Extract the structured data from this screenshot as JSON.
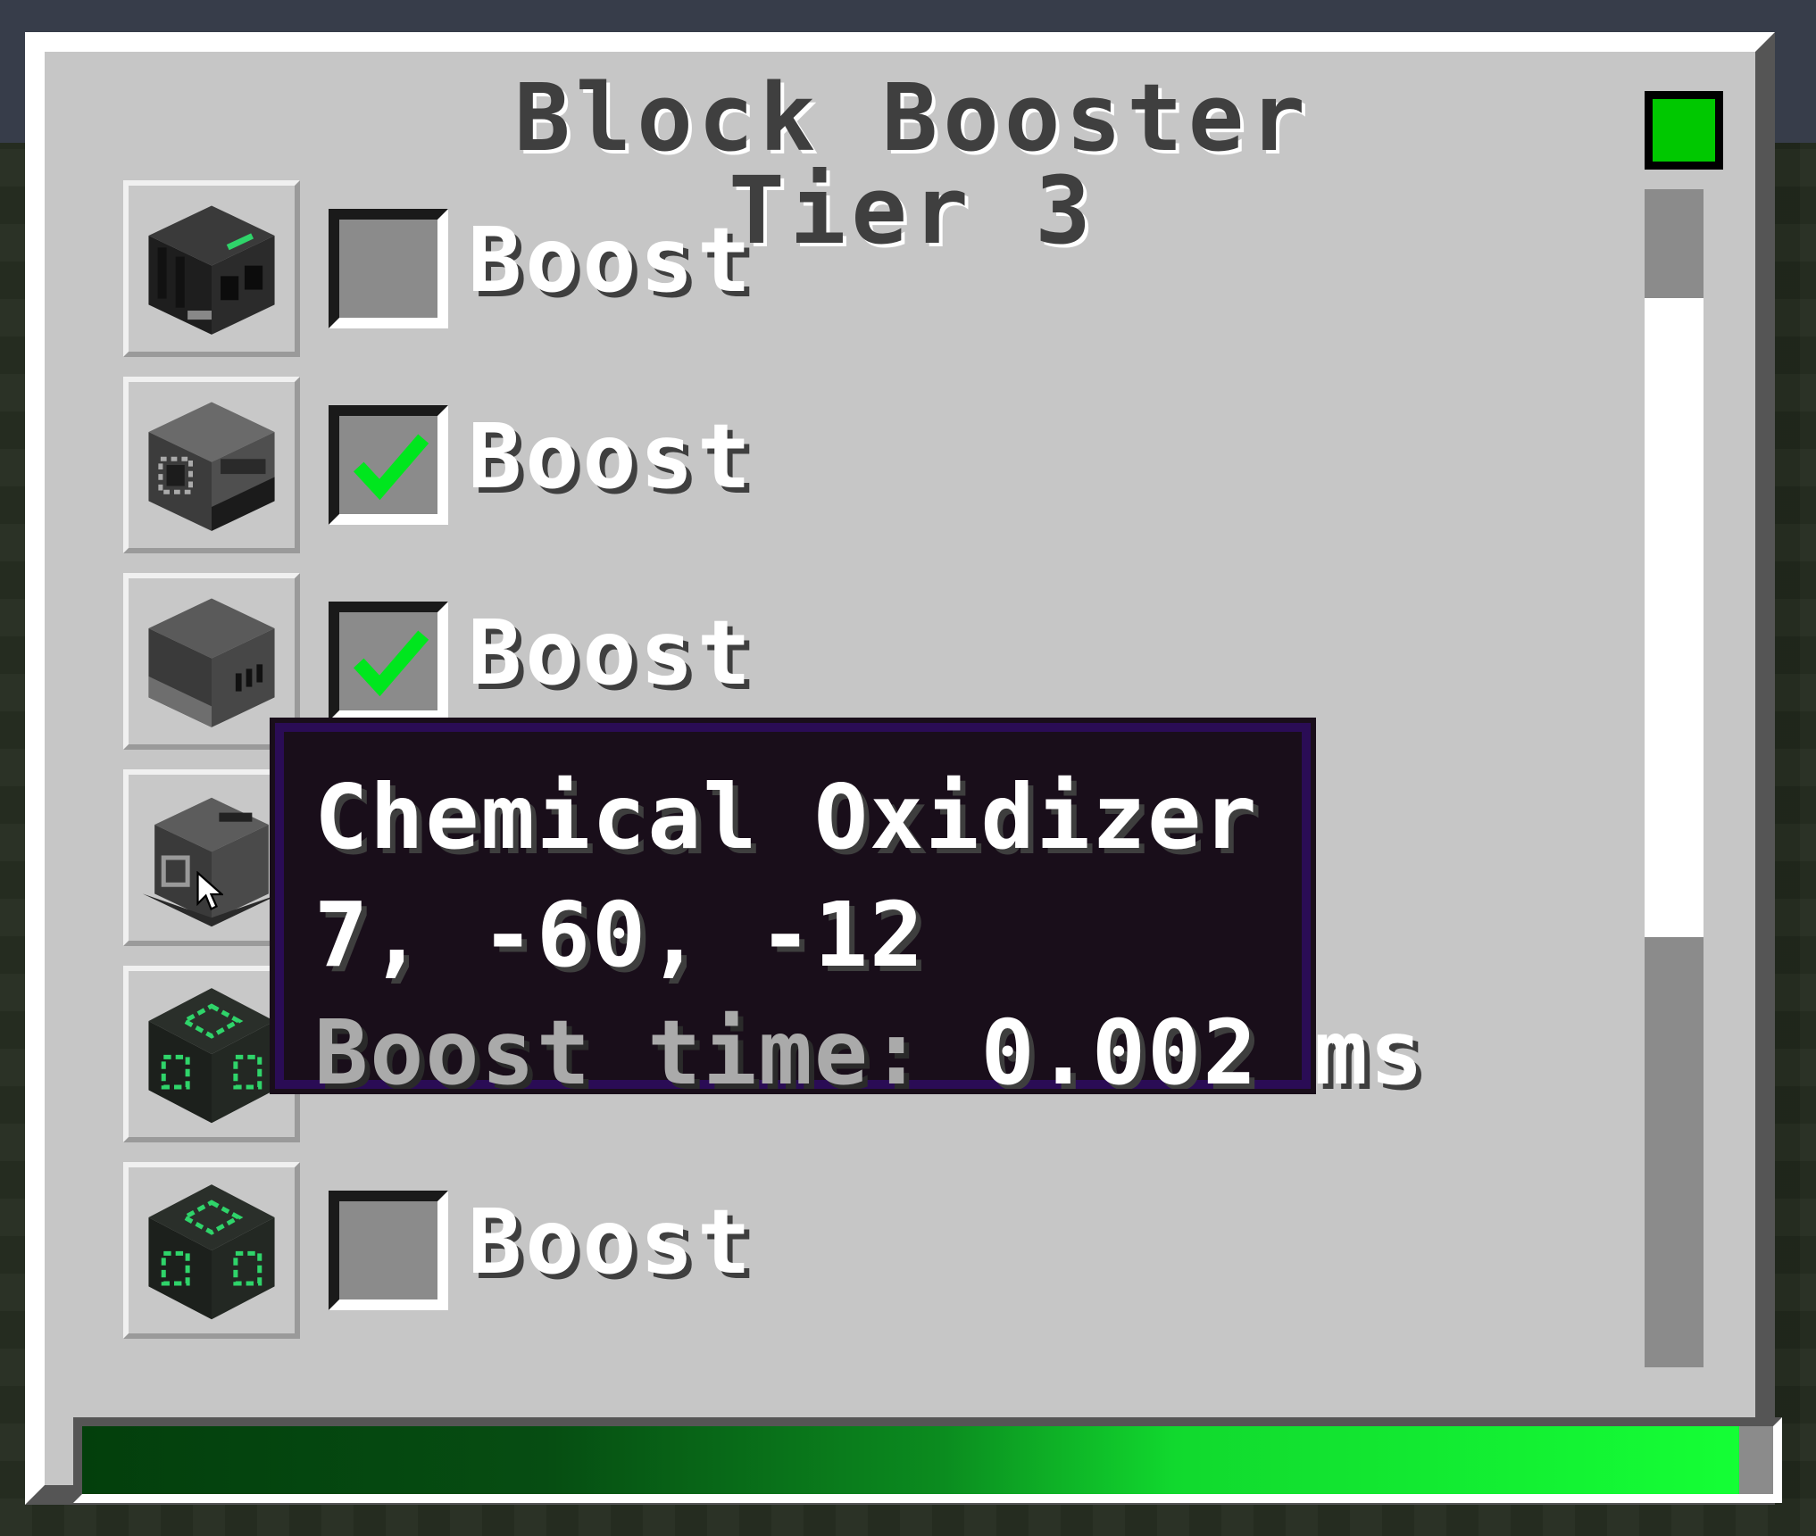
{
  "window": {
    "title": "Block Booster Tier 3",
    "status_color": "#00c800"
  },
  "rows": [
    {
      "block_icon": "machine-dark-block-icon",
      "checked": false,
      "label": "Boost"
    },
    {
      "block_icon": "machine-grey-block-icon",
      "checked": true,
      "label": "Boost"
    },
    {
      "block_icon": "machine-furnace-block-icon",
      "checked": true,
      "label": "Boost"
    },
    {
      "block_icon": "chemical-oxidizer-block-icon",
      "checked": null,
      "label": ""
    },
    {
      "block_icon": "green-circuit-block-icon",
      "checked": null,
      "label": ""
    },
    {
      "block_icon": "green-circuit-block-icon",
      "checked": false,
      "label": "Boost"
    }
  ],
  "tooltip": {
    "name": "Chemical Oxidizer",
    "coords": "7, -60, -12",
    "boost_time_label": "Boost time: ",
    "boost_time_value": "0.002 ms"
  },
  "scrollbar": {
    "position": 0.1,
    "visible_fraction": 0.55
  },
  "energy": {
    "fill_fraction": 0.98,
    "gradient": [
      "#033f0c",
      "#14ff35"
    ]
  },
  "colors": {
    "panel": "#c6c6c6",
    "check": "#00e61e",
    "tooltip_bg": "#190e1a",
    "tooltip_border": "#2a0c55"
  }
}
